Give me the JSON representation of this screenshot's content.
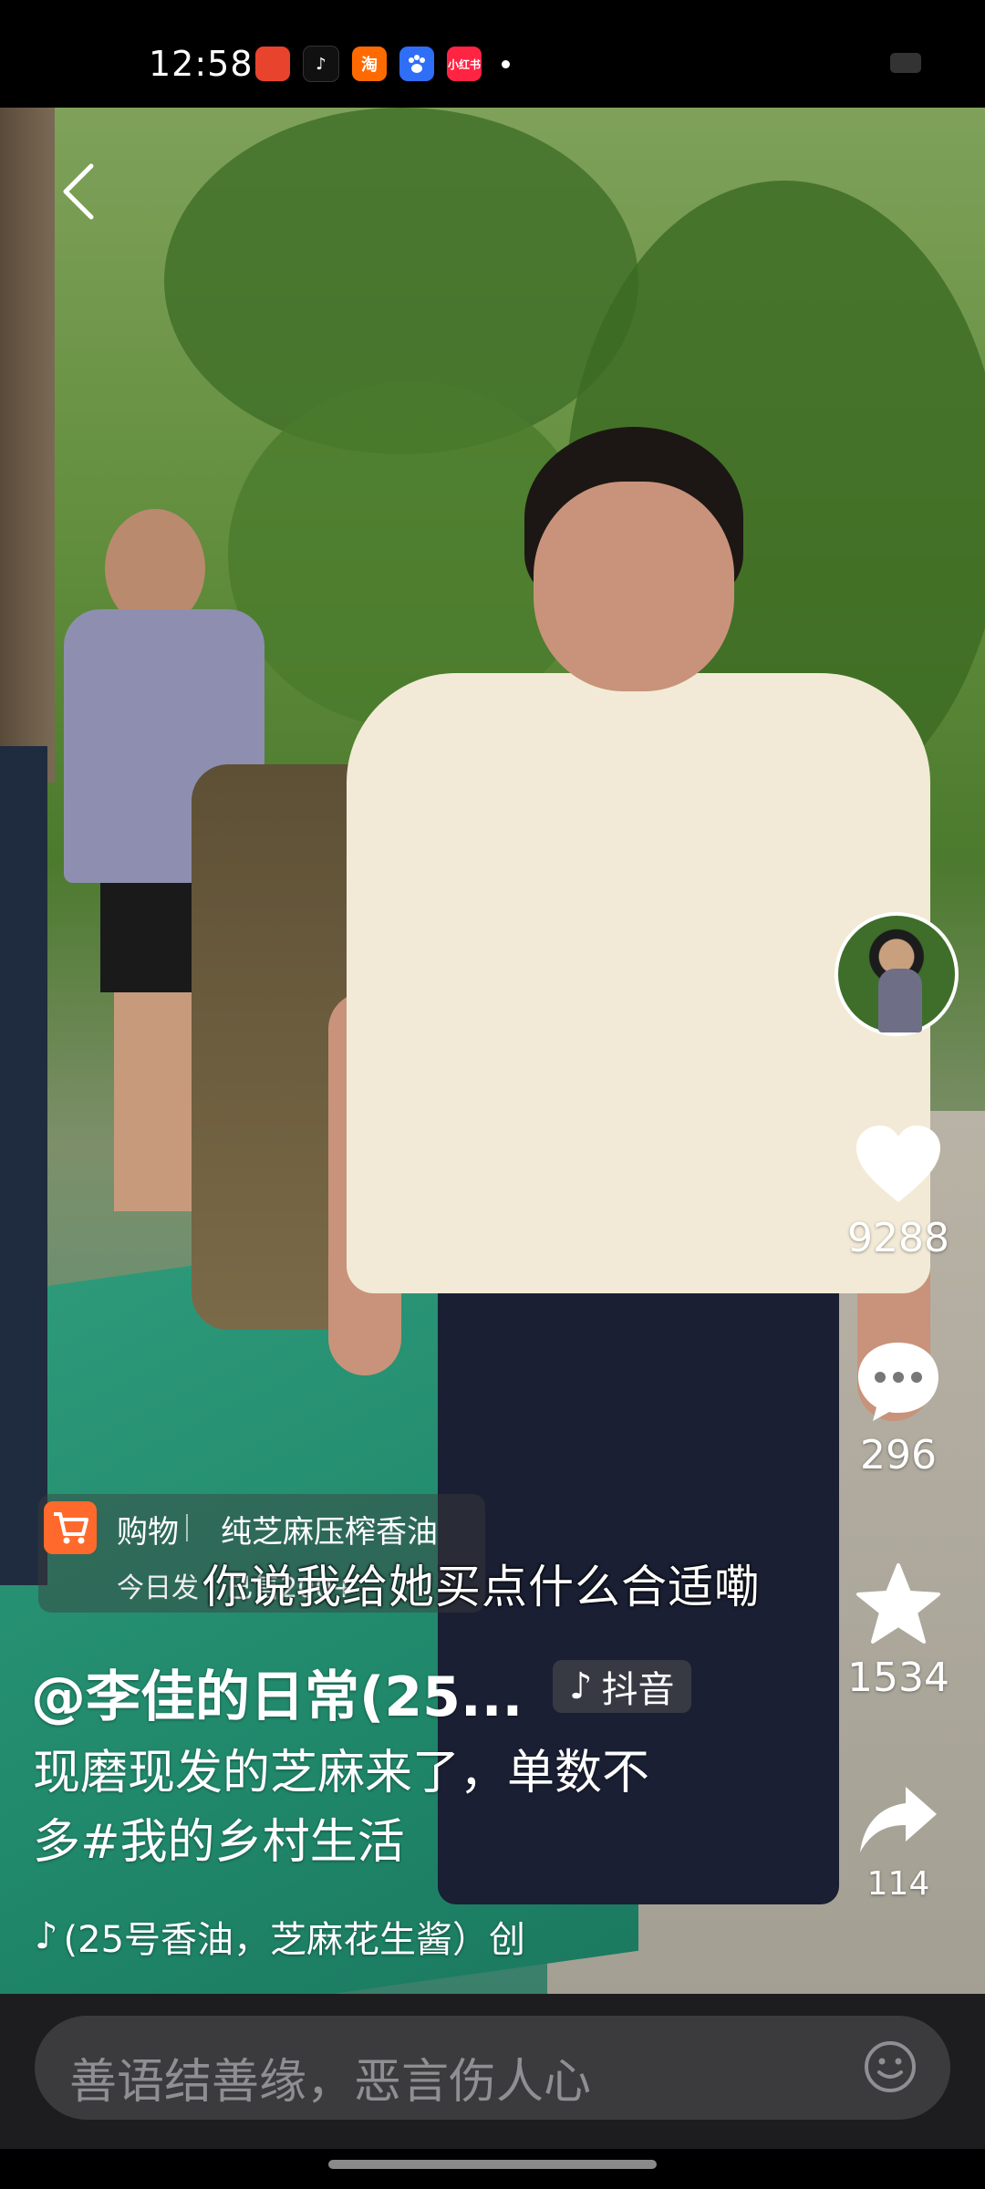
{
  "status_bar": {
    "time": "12:58",
    "apps": [
      {
        "name": "app-1",
        "color": "#e8432d",
        "glyph": ""
      },
      {
        "name": "douyin",
        "color": "#111111",
        "glyph": "♪"
      },
      {
        "name": "taobao",
        "color": "#ff6a00",
        "glyph": "淘"
      },
      {
        "name": "baidu",
        "color": "#2f6ef7",
        "glyph": ""
      },
      {
        "name": "xiaohongshu",
        "color": "#ff2442",
        "glyph": "小红书"
      }
    ]
  },
  "rail": {
    "like_count": "9288",
    "comment_count": "296",
    "favorite_count": "1534",
    "share_count": "114"
  },
  "shop": {
    "tag": "购物",
    "title": "纯芝麻压榨香油",
    "sub": "今日发 | 已售200+"
  },
  "video": {
    "subtitle": "你说我给她买点什么合适嘞"
  },
  "post": {
    "author": "@李佳的日常(25...",
    "badge": "抖音",
    "description": "现磨现发的芝麻来了，单数不多#我的乡村生活",
    "music": "(25号香油，芝麻花生酱）创"
  },
  "comment": {
    "placeholder": "善语结善缘，恶言伤人心"
  },
  "colors": {
    "shop_orange": "#ff6a2c",
    "comment_bg": "#1d1d1f",
    "input_bg": "#3b3b3d"
  }
}
